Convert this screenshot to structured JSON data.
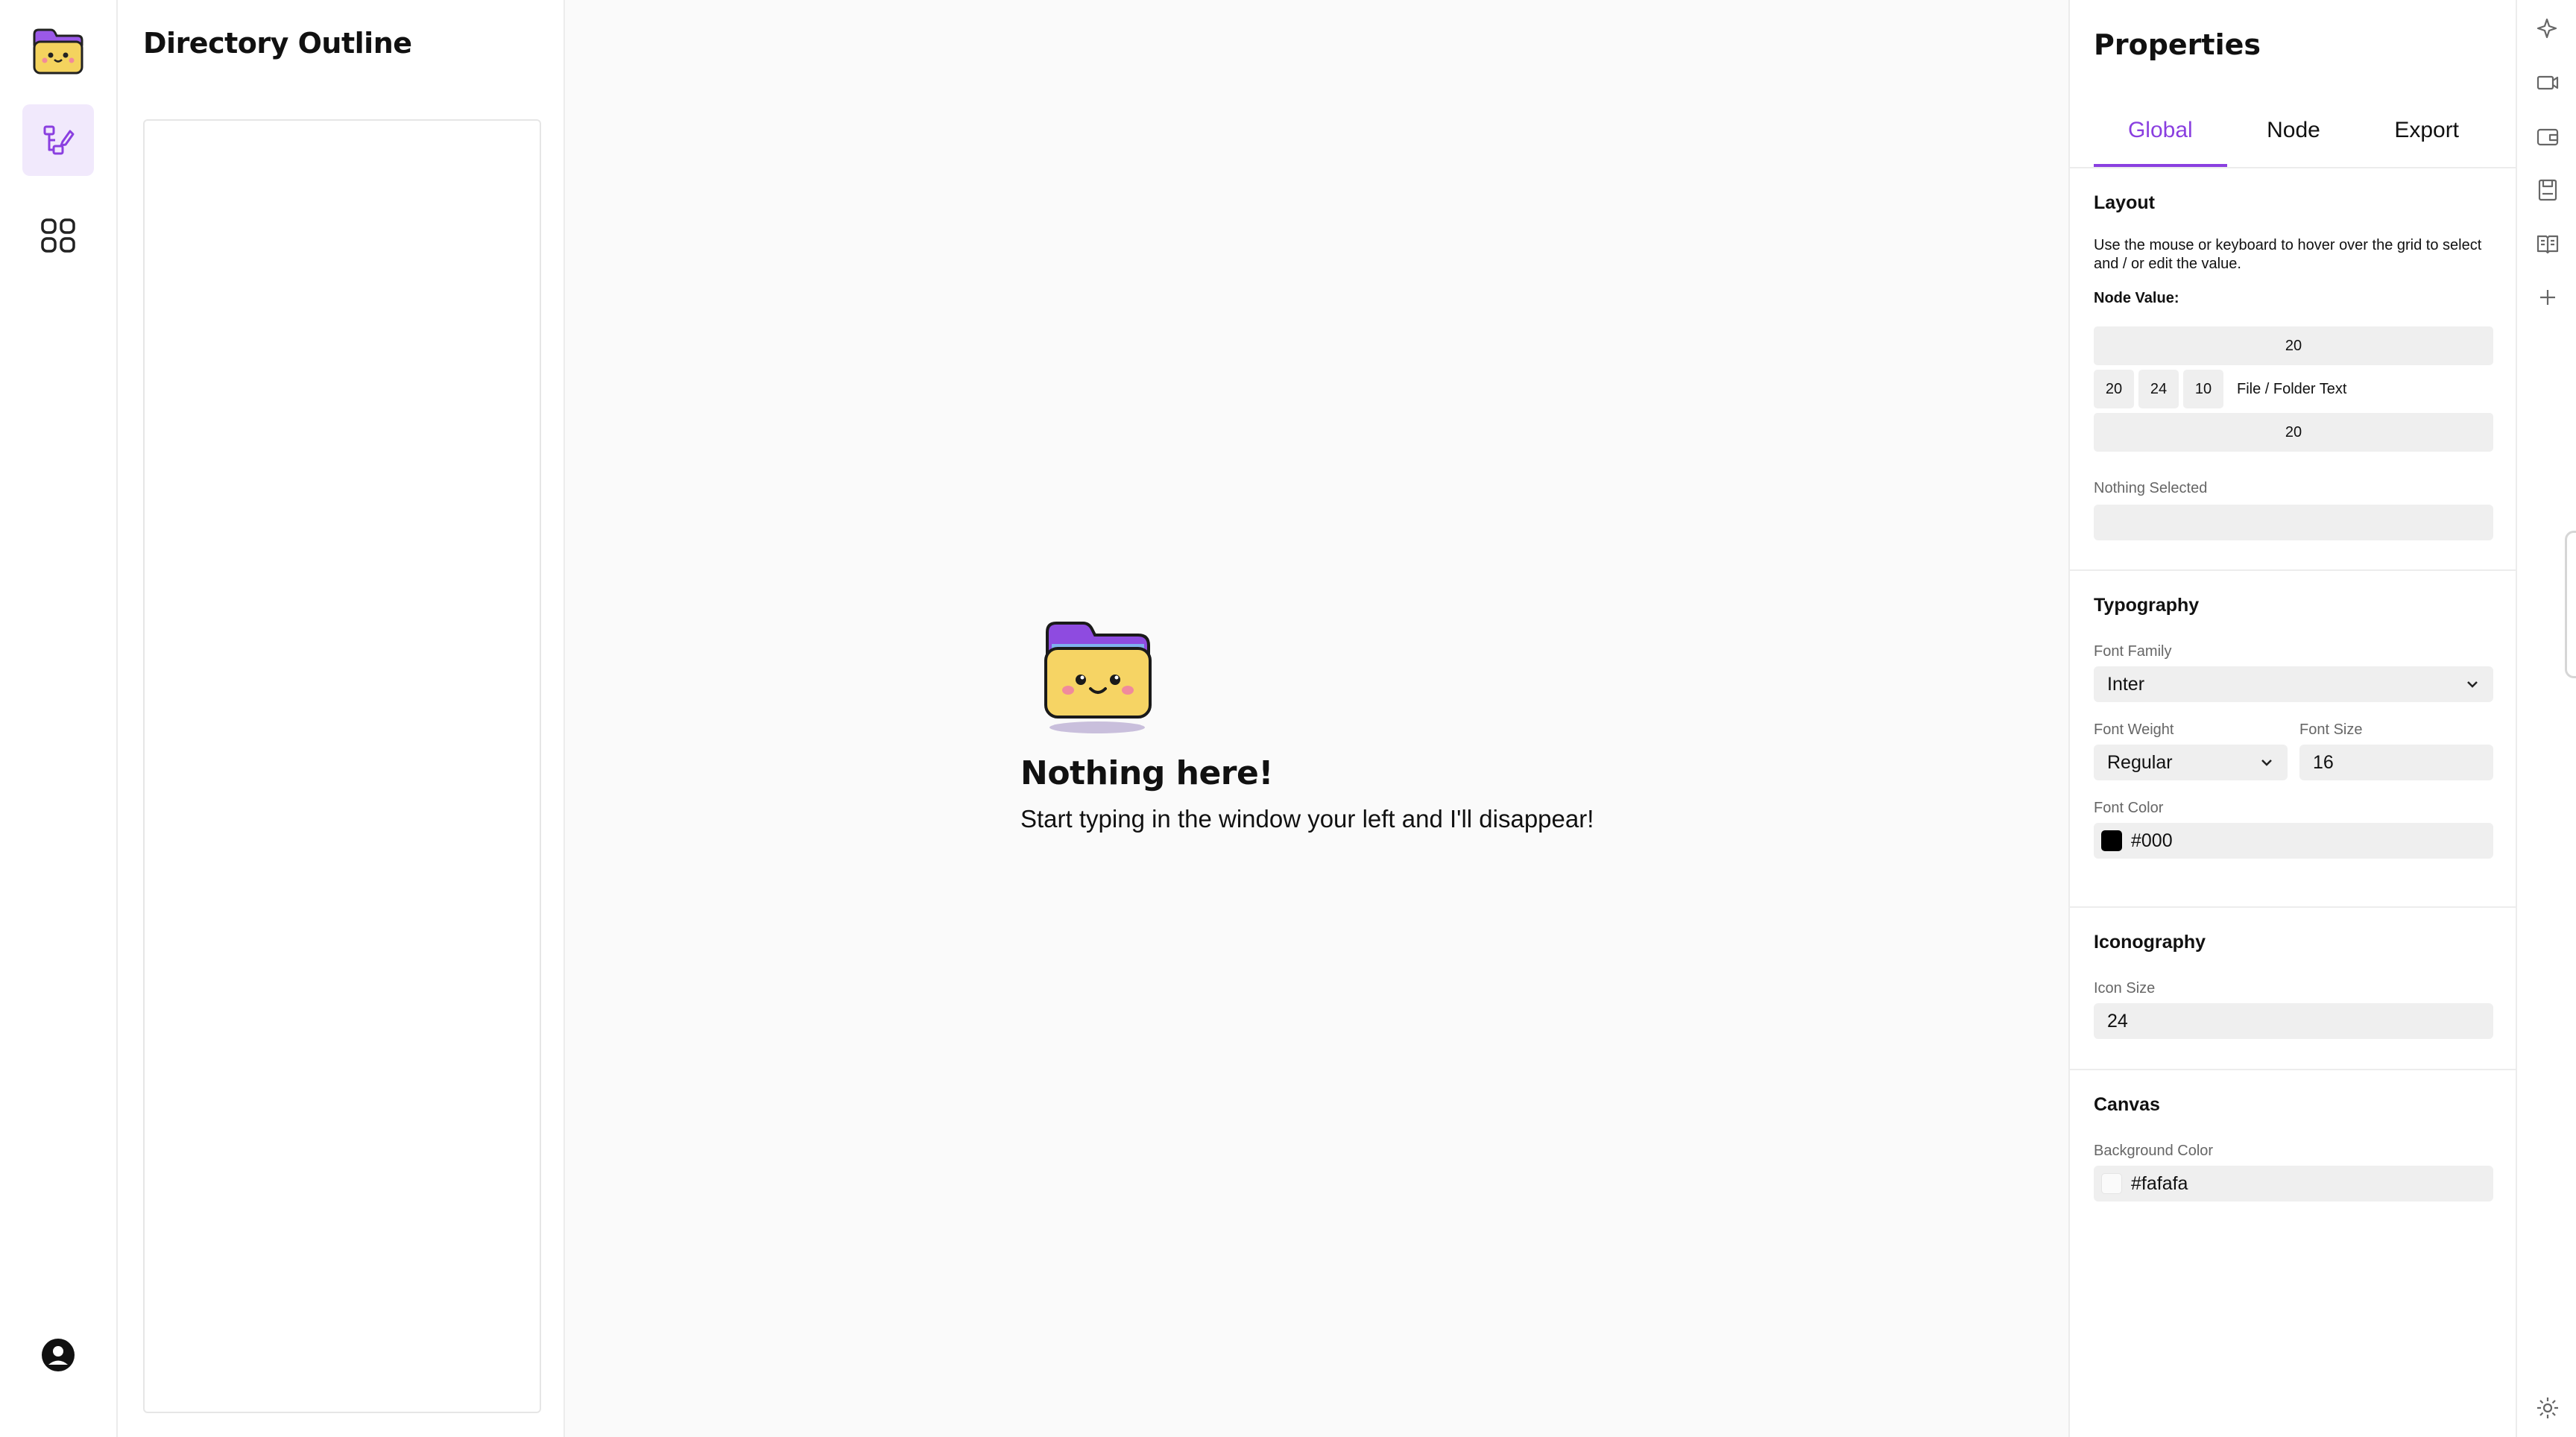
{
  "outline": {
    "title": "Directory Outline"
  },
  "empty_state": {
    "title": "Nothing here!",
    "message": "Start typing in the window your left and I'll disappear!"
  },
  "properties": {
    "title": "Properties",
    "tabs": [
      {
        "label": "Global",
        "active": true
      },
      {
        "label": "Node",
        "active": false
      },
      {
        "label": "Export",
        "active": false
      }
    ],
    "layout": {
      "title": "Layout",
      "description": "Use the mouse or keyboard to hover over the grid to select and / or edit the value.",
      "node_value_label": "Node Value:",
      "top": "20",
      "left": "20",
      "icon": "24",
      "gap": "10",
      "content": "File / Folder Text",
      "bottom": "20",
      "selection_label": "Nothing Selected",
      "selection_value": ""
    },
    "typography": {
      "title": "Typography",
      "font_family_label": "Font Family",
      "font_family": "Inter",
      "font_weight_label": "Font Weight",
      "font_weight": "Regular",
      "font_size_label": "Font Size",
      "font_size": "16",
      "font_color_label": "Font Color",
      "font_color": "#000"
    },
    "iconography": {
      "title": "Iconography",
      "icon_size_label": "Icon Size",
      "icon_size": "24"
    },
    "canvas": {
      "title": "Canvas",
      "bg_label": "Background Color",
      "bg_color": "#fafafa"
    }
  },
  "colors": {
    "accent": "#8a3fe0",
    "accent_bg": "#f1e9fc"
  },
  "right_tools": [
    "sparkle-icon",
    "video-icon",
    "wallet-icon",
    "save-icon",
    "book-icon",
    "plus-icon",
    "settings-icon"
  ]
}
